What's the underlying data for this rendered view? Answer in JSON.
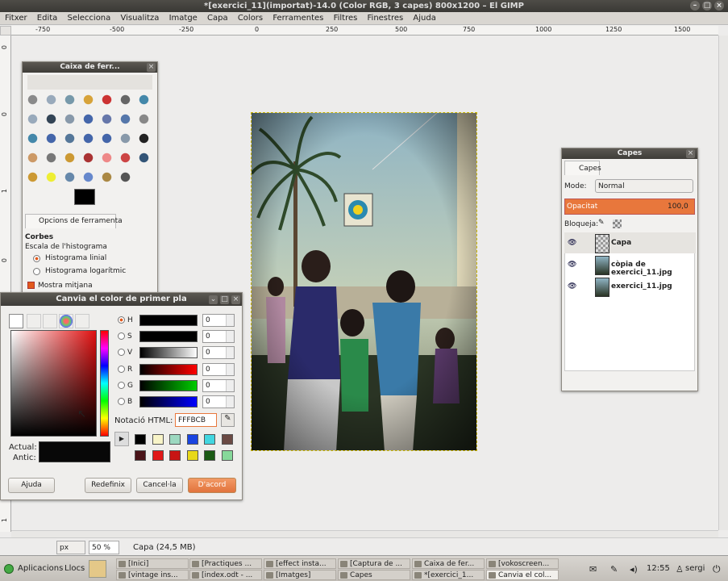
{
  "window": {
    "title": "*[exercici_11](importat)-14.0 (Color RGB, 3 capes) 800x1200 – El GIMP"
  },
  "menu": [
    "Fitxer",
    "Edita",
    "Selecciona",
    "Visualitza",
    "Imatge",
    "Capa",
    "Colors",
    "Ferramentes",
    "Filtres",
    "Finestres",
    "Ajuda"
  ],
  "hruler": [
    "-750",
    "-500",
    "-250",
    "0",
    "250",
    "500",
    "750",
    "1000",
    "1250",
    "1500"
  ],
  "vruler": [
    "0",
    "0",
    "1",
    "0",
    "0",
    "1"
  ],
  "toolbox": {
    "title": "Caixa de ferr...",
    "tab": "Opcions de ferramenta",
    "section": "Corbes",
    "subsection": "Escala de l'histograma",
    "opt_linear": "Histograma linial",
    "opt_log": "Histograma logarítmic",
    "show_merged": "Mostra mitjana"
  },
  "color_dialog": {
    "title": "Canvia el color de primer pla",
    "channels": [
      {
        "label": "H",
        "value": "0"
      },
      {
        "label": "S",
        "value": "0"
      },
      {
        "label": "V",
        "value": "0"
      },
      {
        "label": "R",
        "value": "0"
      },
      {
        "label": "G",
        "value": "0"
      },
      {
        "label": "B",
        "value": "0"
      }
    ],
    "html_label": "Notació HTML:",
    "html_value": "FFFBCB",
    "current_label": "Actual:",
    "old_label": "Antic:",
    "buttons": {
      "help": "Ajuda",
      "reset": "Redefinix",
      "cancel": "Cancel·la",
      "ok": "D'acord"
    },
    "history_colors": [
      "#000000",
      "#f8f4c8",
      "#9cd8c0",
      "#1a44e0",
      "#42d6e0",
      "#6b4a44",
      "#4a1418",
      "#e01818",
      "#c81414",
      "#e8d818",
      "#1a5a14",
      "#86d89a"
    ]
  },
  "layers": {
    "title": "Capes",
    "tab": "Capes",
    "mode_label": "Mode:",
    "mode_value": "Normal",
    "opacity_label": "Opacitat",
    "opacity_value": "100,0",
    "lock_label": "Bloqueja:",
    "items": [
      {
        "name": "Capa"
      },
      {
        "name": "còpia de exercici_11.jpg"
      },
      {
        "name": "exercici_11.jpg"
      }
    ]
  },
  "status": {
    "unit": "px",
    "zoom": "50 %",
    "info": "Capa (24,5 MB)"
  },
  "taskbar": {
    "apps": "Aplicacions",
    "places": "Llocs",
    "tasks_top": [
      "[Inici]",
      "[Practiques ...",
      "[effect insta...",
      "[Captura de ...",
      "Caixa de fer...",
      "[vokoscreen..."
    ],
    "tasks_bottom": [
      "[vintage ins...",
      "[index.odt - ...",
      "[Imatges]",
      "Capes",
      "*[exercici_1...",
      "Canvia el col..."
    ],
    "clock": "12:55",
    "user": "sergi"
  },
  "colors": {
    "accent": "#e8773c",
    "title_dark": "#3e3c38"
  }
}
